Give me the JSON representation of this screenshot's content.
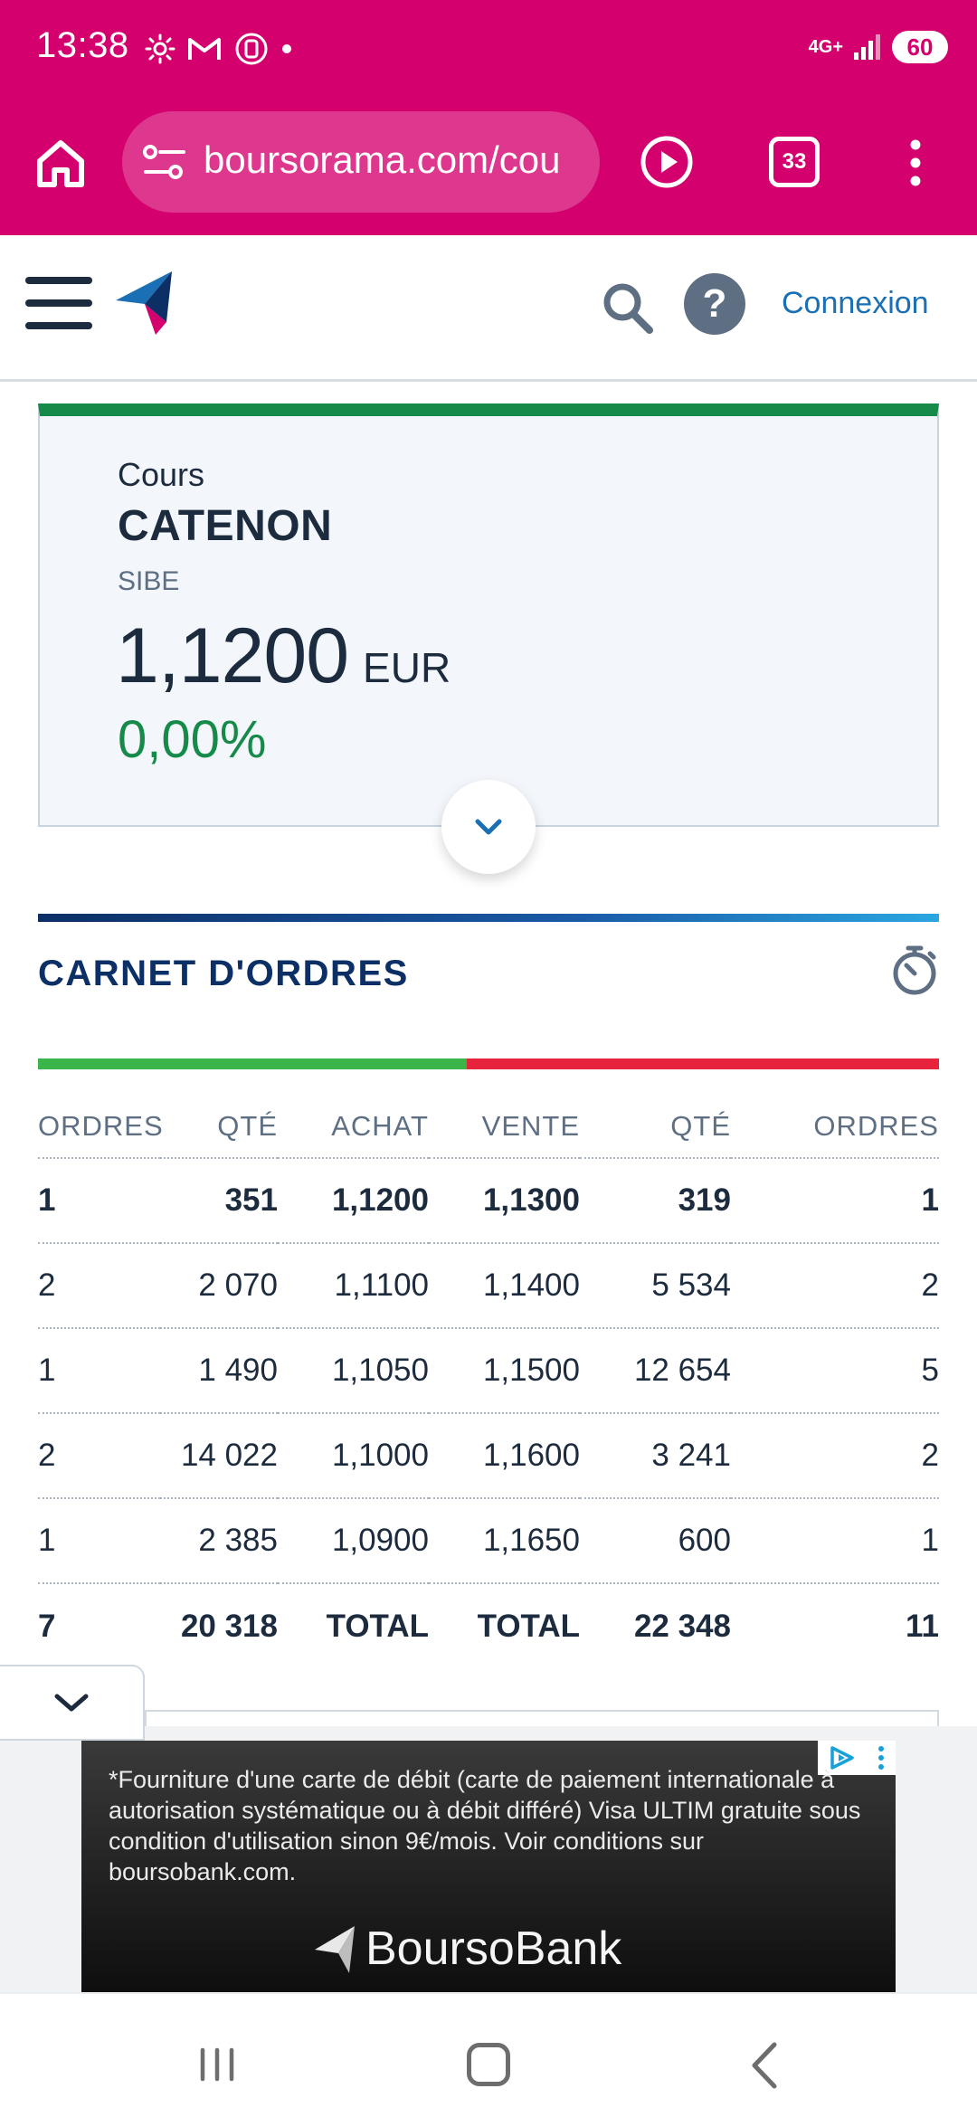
{
  "status_bar": {
    "time": "13:38",
    "network": "4G+",
    "battery": "60"
  },
  "browser": {
    "url": "boursorama.com/cou",
    "tab_count": "33",
    "accent_color": "#d4006e"
  },
  "site_header": {
    "connexion_label": "Connexion"
  },
  "quote": {
    "label": "Cours",
    "name": "CATENON",
    "market": "SIBE",
    "price": "1,1200",
    "currency": "EUR",
    "change": "0,00%",
    "change_color": "#168a49"
  },
  "order_book": {
    "title": "CARNET D'ORDRES",
    "headers": [
      "ORDRES",
      "QTÉ",
      "ACHAT",
      "VENTE",
      "QTÉ",
      "ORDRES"
    ],
    "rows": [
      [
        "1",
        "351",
        "1,1200",
        "1,1300",
        "319",
        "1"
      ],
      [
        "2",
        "2 070",
        "1,1100",
        "1,1400",
        "5 534",
        "2"
      ],
      [
        "1",
        "1 490",
        "1,1050",
        "1,1500",
        "12 654",
        "5"
      ],
      [
        "2",
        "14 022",
        "1,1000",
        "1,1600",
        "3 241",
        "2"
      ],
      [
        "1",
        "2 385",
        "1,0900",
        "1,1650",
        "600",
        "1"
      ]
    ],
    "total_row": [
      "7",
      "20 318",
      "TOTAL",
      "TOTAL",
      "22 348",
      "11"
    ],
    "buy_color": "#3bb54a",
    "sell_color": "#e6223d"
  },
  "ad": {
    "text": "*Fourniture d'une carte de débit (carte de paiement internationale à autorisation systématique ou à débit différé) Visa ULTIM gratuite sous condition d'utilisation sinon 9€/mois. Voir conditions sur boursobank.com.",
    "brand": "BoursoBank"
  }
}
